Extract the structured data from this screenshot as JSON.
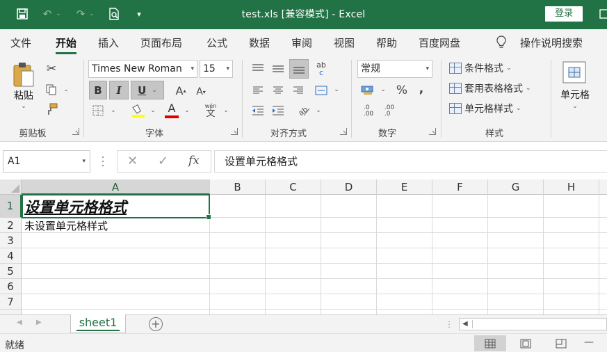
{
  "titlebar": {
    "title": "test.xls  [兼容模式]  -  Excel",
    "login": "登录",
    "qat_more": "⌄"
  },
  "tabs": [
    {
      "label": "文件"
    },
    {
      "label": "开始",
      "active": true
    },
    {
      "label": "插入"
    },
    {
      "label": "页面布局"
    },
    {
      "label": "公式"
    },
    {
      "label": "数据"
    },
    {
      "label": "审阅"
    },
    {
      "label": "视图"
    },
    {
      "label": "帮助"
    },
    {
      "label": "百度网盘"
    }
  ],
  "tell_me": "操作说明搜索",
  "ribbon": {
    "clipboard": {
      "paste": "粘贴",
      "label": "剪贴板"
    },
    "font": {
      "name": "Times New Roman",
      "size": "15",
      "bold": "B",
      "italic": "I",
      "underline": "U",
      "grow": "A",
      "shrink": "A",
      "font_color_glyph": "A",
      "wen": "wén",
      "wen_char": "文",
      "label": "字体"
    },
    "alignment": {
      "label": "对齐方式",
      "wrap_glyph": "ab",
      "wrap_glyph2": "c"
    },
    "number": {
      "format": "常规",
      "percent": "%",
      "comma": ",",
      "inc": ".0\n.00",
      "dec": ".00\n.0",
      "label": "数字"
    },
    "styles": {
      "conditional": "条件格式",
      "table": "套用表格格式",
      "cell": "单元格样式",
      "label": "样式"
    },
    "cells": {
      "label": "单元格"
    }
  },
  "formula_bar": {
    "name_box": "A1",
    "fx": "fx",
    "content": "设置单元格格式"
  },
  "columns": [
    "A",
    "B",
    "C",
    "D",
    "E",
    "F",
    "G",
    "H"
  ],
  "rows": [
    "1",
    "2",
    "3",
    "4",
    "5",
    "6",
    "7"
  ],
  "cells": {
    "A1": "设置单元格格式",
    "A2": "未设置单元格样式"
  },
  "sheets": [
    {
      "label": "sheet1"
    }
  ],
  "add_sheet": "+",
  "status": "就绪",
  "zoom_minus": "—",
  "colors": {
    "accent": "#217346",
    "font_color_bar": "#e00000",
    "highlight_bar": "#ffff00"
  }
}
